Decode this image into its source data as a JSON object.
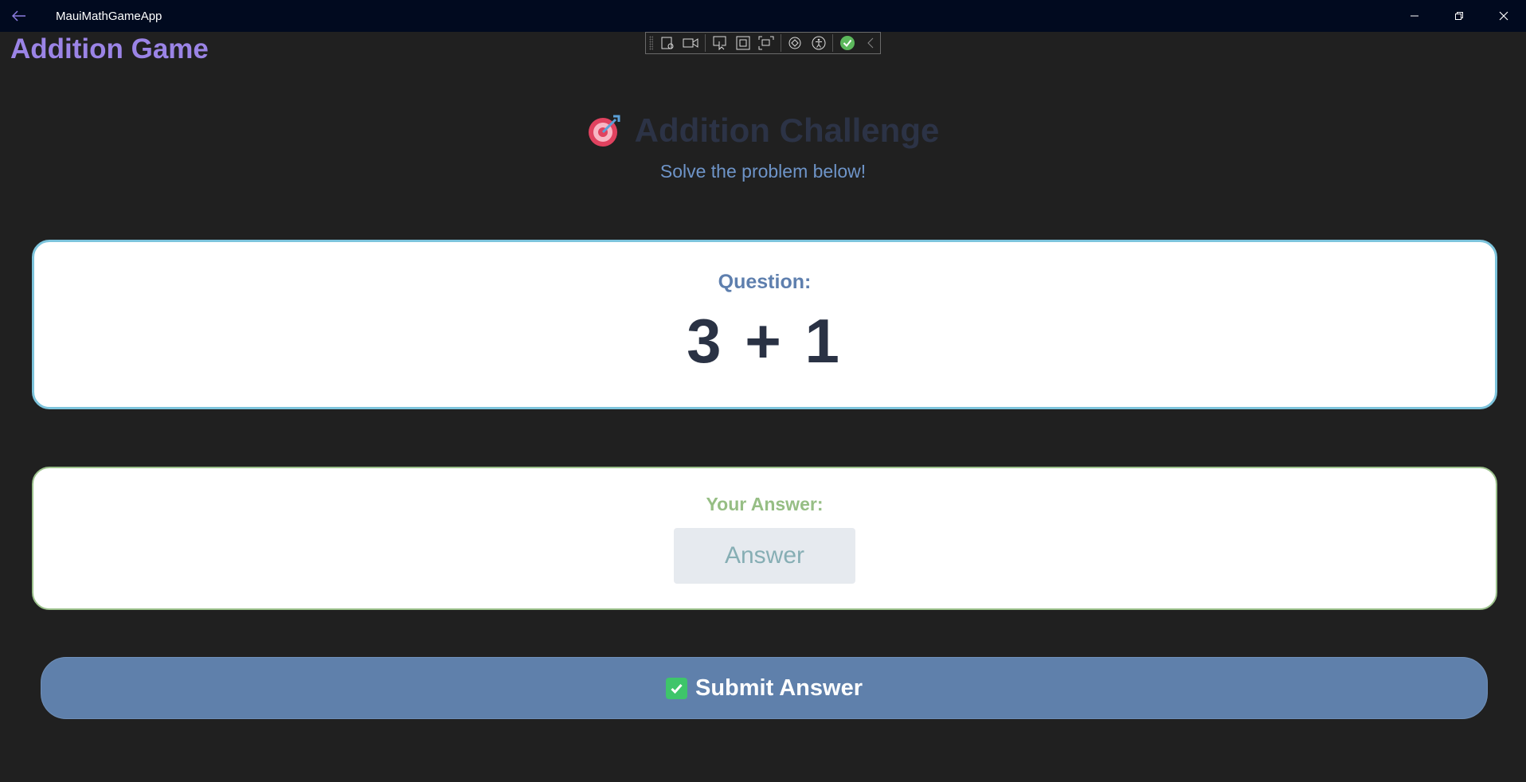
{
  "window": {
    "title": "MauiMathGameApp"
  },
  "page": {
    "title": "Addition Game"
  },
  "header": {
    "challenge_title": "Addition Challenge",
    "subtitle": "Solve the problem below!"
  },
  "question_card": {
    "label": "Question:",
    "expression": "3 + 1"
  },
  "answer_card": {
    "label": "Your Answer:",
    "placeholder": "Answer",
    "value": ""
  },
  "submit": {
    "label": "Submit Answer"
  },
  "icons": {
    "back": "arrow-left-icon",
    "target": "target-icon",
    "check": "check-box-icon"
  },
  "colors": {
    "accent": "#9b84e6",
    "button": "#5f80ab",
    "question_border": "#7dc4dc",
    "answer_border": "#9cc28c"
  }
}
